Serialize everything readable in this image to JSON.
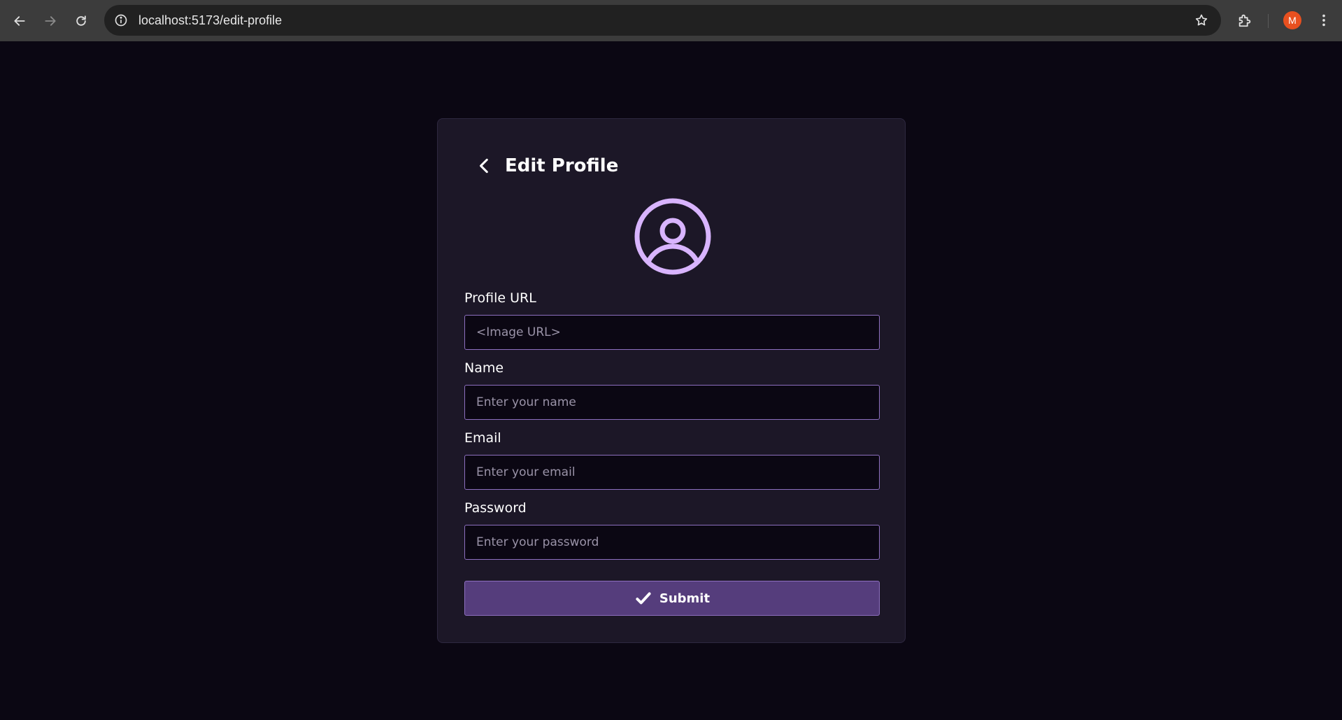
{
  "browser": {
    "url": "localhost:5173/edit-profile",
    "profile_initial": "M"
  },
  "page": {
    "title": "Edit Profile"
  },
  "form": {
    "profile_url": {
      "label": "Profile URL",
      "placeholder": "<Image URL>",
      "value": ""
    },
    "name": {
      "label": "Name",
      "placeholder": "Enter your name",
      "value": ""
    },
    "email": {
      "label": "Email",
      "placeholder": "Enter your email",
      "value": ""
    },
    "password": {
      "label": "Password",
      "placeholder": "Enter your password",
      "value": ""
    },
    "submit_label": "Submit"
  },
  "colors": {
    "background": "#0b0713",
    "card": "#1c1727",
    "accent": "#d8b4fe",
    "input_border": "#8d6fbf",
    "button": "#553d7c"
  }
}
